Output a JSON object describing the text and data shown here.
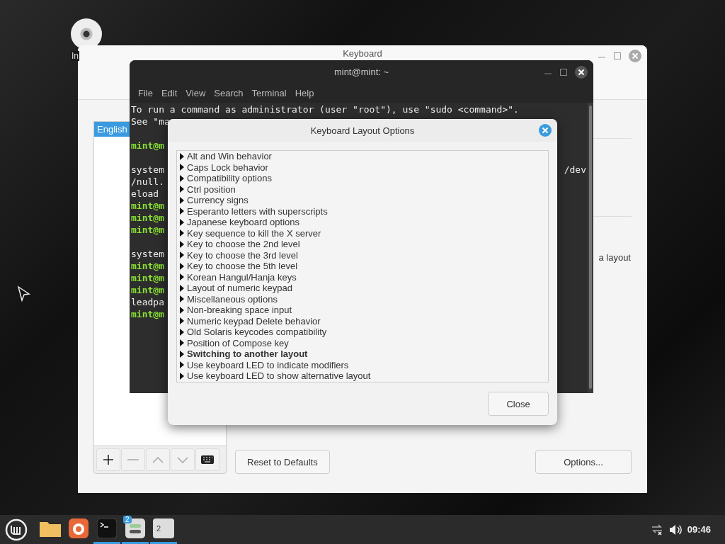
{
  "desktop": {
    "icon_label": "In"
  },
  "keyboard_window": {
    "title": "Keyboard",
    "layouts": [
      {
        "label": "English",
        "selected": true
      }
    ],
    "hint_text": "a layout",
    "reset_button": "Reset to Defaults",
    "options_button": "Options..."
  },
  "terminal": {
    "title": "mint@mint: ~",
    "menu": [
      "File",
      "Edit",
      "View",
      "Search",
      "Terminal",
      "Help"
    ],
    "lines": [
      {
        "kind": "output",
        "text": "To run a command as administrator (user \"root\"), use \"sudo <command>\"."
      },
      {
        "kind": "output",
        "text": "See \"ma"
      },
      {
        "kind": "blank"
      },
      {
        "kind": "prompt",
        "text": "mint@m"
      },
      {
        "kind": "blank"
      },
      {
        "kind": "output",
        "text": "system",
        "tail": "/dev"
      },
      {
        "kind": "output",
        "text": "/null."
      },
      {
        "kind": "output",
        "text": "eload"
      },
      {
        "kind": "prompt",
        "text": "mint@m"
      },
      {
        "kind": "prompt",
        "text": "mint@m"
      },
      {
        "kind": "prompt",
        "text": "mint@m"
      },
      {
        "kind": "blank"
      },
      {
        "kind": "output",
        "text": "system"
      },
      {
        "kind": "prompt",
        "text": "mint@m"
      },
      {
        "kind": "prompt",
        "text": "mint@m"
      },
      {
        "kind": "prompt",
        "text": "mint@m"
      },
      {
        "kind": "output",
        "text": "leadpa"
      },
      {
        "kind": "prompt",
        "text": "mint@m"
      }
    ]
  },
  "dialog": {
    "title": "Keyboard Layout Options",
    "options": [
      {
        "label": "Alt and Win behavior",
        "highlighted": false
      },
      {
        "label": "Caps Lock behavior",
        "highlighted": false
      },
      {
        "label": "Compatibility options",
        "highlighted": false
      },
      {
        "label": "Ctrl position",
        "highlighted": false
      },
      {
        "label": "Currency signs",
        "highlighted": false
      },
      {
        "label": "Esperanto letters with superscripts",
        "highlighted": false
      },
      {
        "label": "Japanese keyboard options",
        "highlighted": false
      },
      {
        "label": "Key sequence to kill the X server",
        "highlighted": false
      },
      {
        "label": "Key to choose the 2nd level",
        "highlighted": false
      },
      {
        "label": "Key to choose the 3rd level",
        "highlighted": false
      },
      {
        "label": "Key to choose the 5th level",
        "highlighted": false
      },
      {
        "label": "Korean Hangul/Hanja keys",
        "highlighted": false
      },
      {
        "label": "Layout of numeric keypad",
        "highlighted": false
      },
      {
        "label": "Miscellaneous options",
        "highlighted": false
      },
      {
        "label": "Non-breaking space input",
        "highlighted": false
      },
      {
        "label": "Numeric keypad Delete behavior",
        "highlighted": false
      },
      {
        "label": "Old Solaris keycodes compatibility",
        "highlighted": false
      },
      {
        "label": "Position of Compose key",
        "highlighted": false
      },
      {
        "label": "Switching to another layout",
        "highlighted": true
      },
      {
        "label": "Use keyboard LED to indicate modifiers",
        "highlighted": false
      },
      {
        "label": "Use keyboard LED to show alternative layout",
        "highlighted": false
      }
    ],
    "close_button": "Close"
  },
  "taskbar": {
    "apps": [
      {
        "kind": "folder",
        "running": false
      },
      {
        "kind": "browser",
        "running": false
      },
      {
        "kind": "terminal",
        "running": true
      },
      {
        "kind": "switch",
        "running": true,
        "badge": "2"
      },
      {
        "kind": "workspace",
        "running": true,
        "label": "2"
      }
    ],
    "clock": "09:46"
  }
}
